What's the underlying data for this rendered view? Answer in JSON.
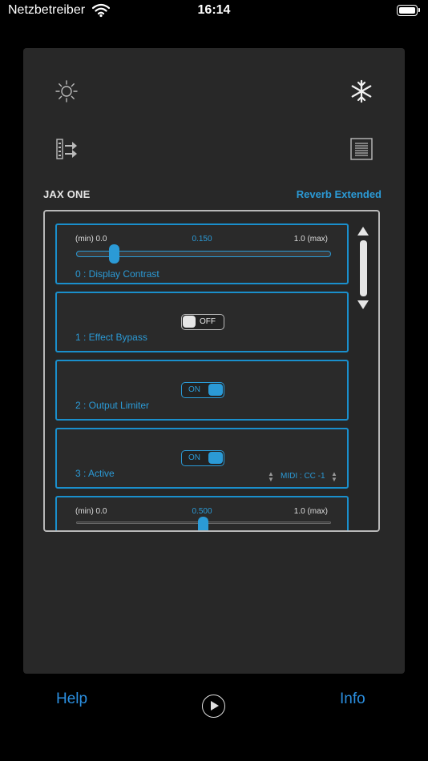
{
  "status": {
    "carrier": "Netzbetreiber",
    "time": "16:14"
  },
  "header": {
    "plugin_name": "JAX ONE",
    "preset_name": "Reverb Extended"
  },
  "icons": {
    "brightness": "sun-icon",
    "freeze": "snowflake-icon",
    "routing": "routing-icon",
    "preset_list": "list-icon"
  },
  "params": [
    {
      "label": "0 : Display Contrast",
      "min": "(min) 0.0",
      "max": "1.0  (max)",
      "value": "0.150",
      "fraction": 0.15
    },
    {
      "label": "1 : Effect Bypass",
      "toggle": "OFF"
    },
    {
      "label": "2 : Output Limiter",
      "toggle": "ON"
    },
    {
      "label": "3 : Active",
      "toggle": "ON",
      "midi": "MIDI : CC -1"
    },
    {
      "min": "(min) 0.0",
      "max": "1.0  (max)",
      "value": "0.500",
      "fraction": 0.5
    }
  ],
  "footer": {
    "help": "Help",
    "info": "Info"
  },
  "colors": {
    "accent": "#2b9ad6",
    "panel": "#282828",
    "link": "#2b8fe0"
  }
}
